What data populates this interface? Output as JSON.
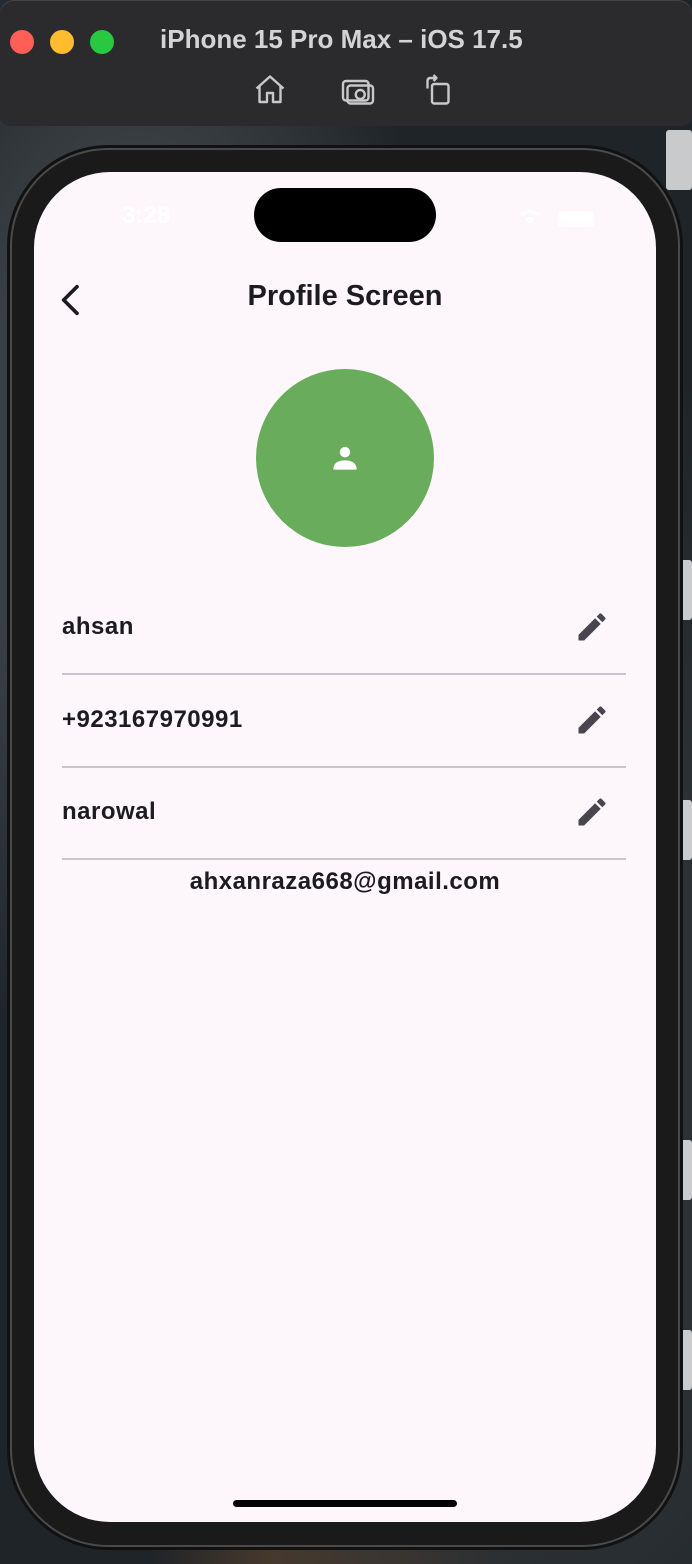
{
  "window": {
    "title": "iPhone 15 Pro Max – iOS 17.5",
    "toolbar_icons": [
      "home-icon",
      "screenshot-icon",
      "rotate-icon"
    ]
  },
  "status_bar": {
    "time": "3:28"
  },
  "header": {
    "title": "Profile Screen",
    "back_icon": "chevron-left-icon"
  },
  "avatar": {
    "icon": "person-icon",
    "color": "#69ad5c"
  },
  "fields": [
    {
      "value": "ahsan",
      "edit_icon": "pencil-icon"
    },
    {
      "value": "+923167970991",
      "edit_icon": "pencil-icon"
    },
    {
      "value": "narowal",
      "edit_icon": "pencil-icon"
    }
  ],
  "email": "ahxanraza668@gmail.com",
  "colors": {
    "screen_background": "#fdf7fc",
    "divider": "#cac4cf",
    "text": "#1c1b1f"
  }
}
